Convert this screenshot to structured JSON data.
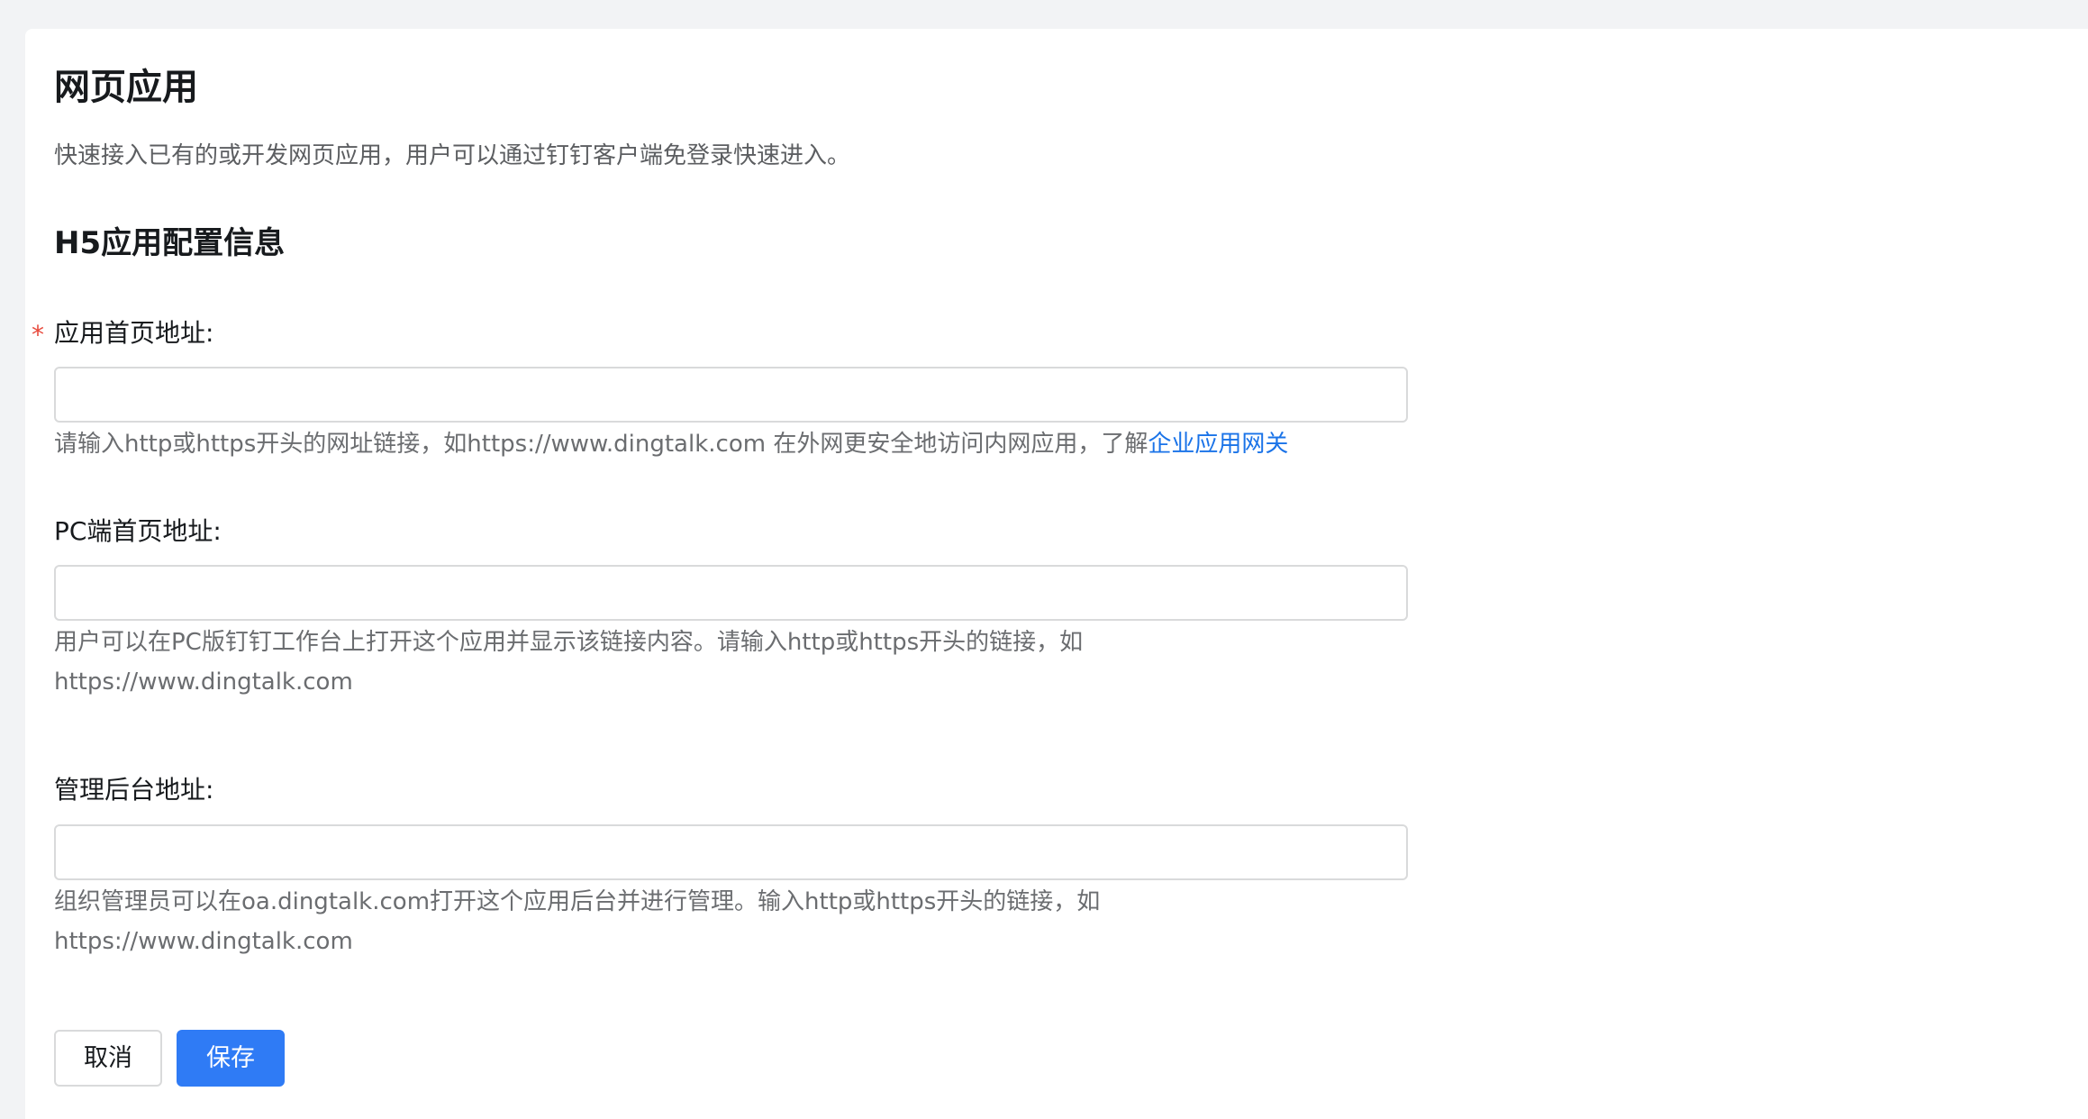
{
  "page": {
    "title": "网页应用",
    "description": "快速接入已有的或开发网页应用，用户可以通过钉钉客户端免登录快速进入。"
  },
  "section": {
    "title": "H5应用配置信息"
  },
  "fields": {
    "homepage": {
      "required_mark": "*",
      "label": "应用首页地址:",
      "value": "",
      "help_text": "请输入http或https开头的网址链接，如https://www.dingtalk.com 在外网更安全地访问内网应用，了解",
      "help_link": "企业应用网关"
    },
    "pc_homepage": {
      "label": "PC端首页地址:",
      "value": "",
      "help_text": "用户可以在PC版钉钉工作台上打开这个应用并显示该链接内容。请输入http或https开头的链接，如https://www.dingtalk.com"
    },
    "admin_url": {
      "label": "管理后台地址:",
      "value": "",
      "help_text": "组织管理员可以在oa.dingtalk.com打开这个应用后台并进行管理。输入http或https开头的链接，如https://www.dingtalk.com"
    }
  },
  "actions": {
    "cancel_label": "取消",
    "save_label": "保存"
  },
  "colors": {
    "primary": "#2f7bf5",
    "link": "#1a73e8",
    "required": "#e84a3d",
    "background": "#f2f3f5"
  }
}
